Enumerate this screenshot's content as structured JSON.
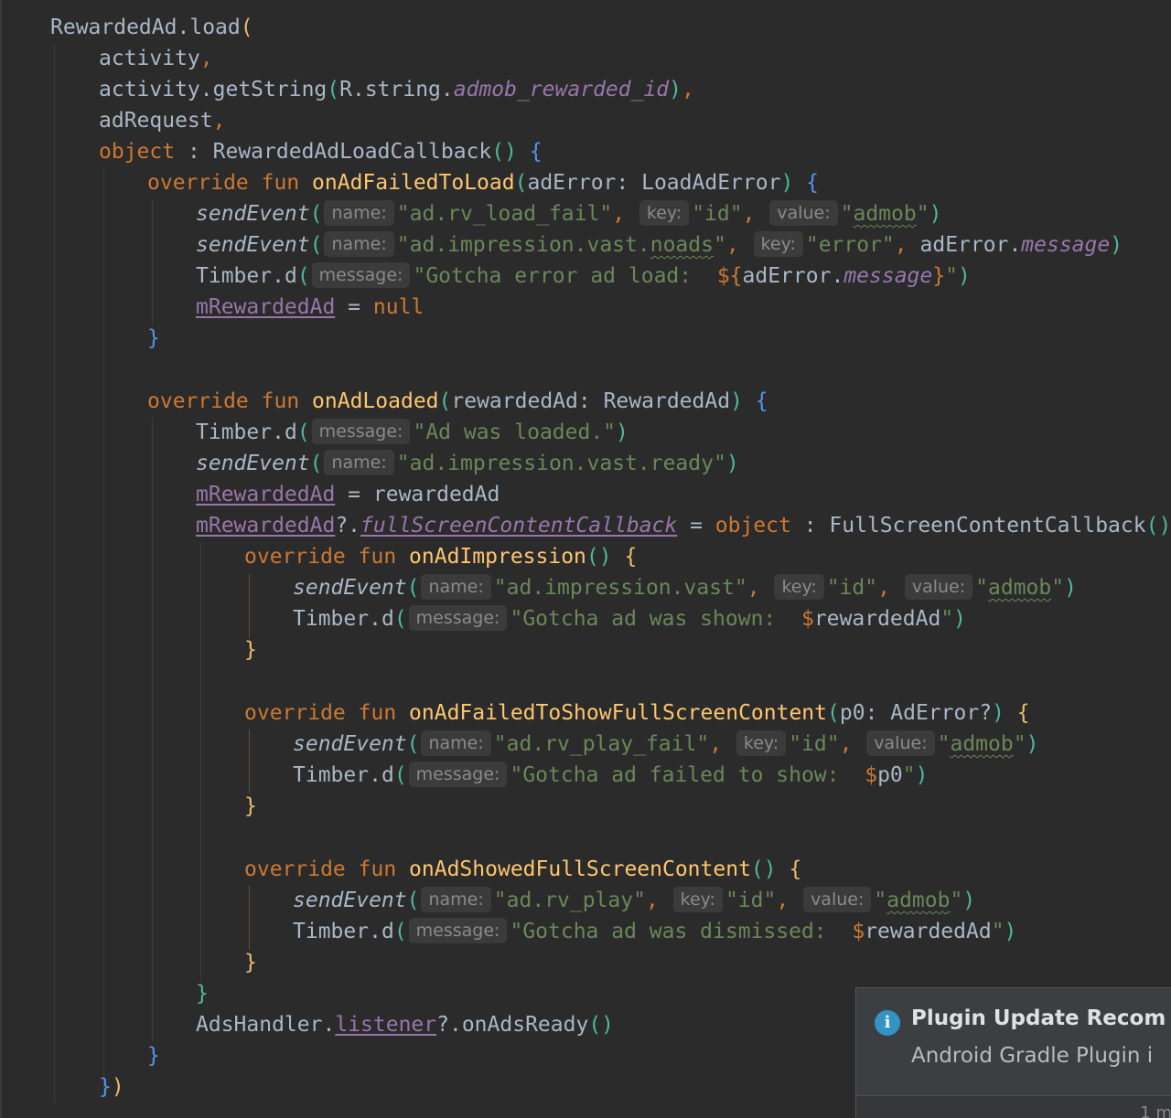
{
  "code": {
    "l1_obj": "RewardedAd",
    "l1_method": "load",
    "l2": "activity",
    "l3_obj": "activity",
    "l3_method": "getString",
    "l3_r": "R.string.",
    "l3_id": "admob_rewarded_id",
    "l4": "adRequest",
    "l5_kw": "object",
    "l5_type": "RewardedAdLoadCallback",
    "override": "override",
    "fun": "fun",
    "f1_name": "onAdFailedToLoad",
    "f1_param": "adError",
    "f1_type": "LoadAdError",
    "send_event": "sendEvent",
    "hint_name": "name:",
    "hint_key": "key:",
    "hint_value": "value:",
    "hint_message": "message:",
    "l7_name": "\"ad.rv_load_fail\"",
    "q_id": "\"id\"",
    "admob": "admob",
    "l8_name_a": "\"ad.impression.vast.",
    "l8_name_b": "noads",
    "l8_key": "\"error\"",
    "ad_error": "adError",
    "message_prop": "message",
    "timber": "Timber",
    "timber_d": "d",
    "l9_str": "\"Gotcha error ad load:  ",
    "m_rewarded_ad": "mRewardedAd",
    "null_kw": "null",
    "f2_name": "onAdLoaded",
    "f2_param": "rewardedAd",
    "f2_type": "RewardedAd",
    "l14_str": "\"Ad was loaded.\"",
    "l15_name": "\"ad.impression.vast.ready\"",
    "rewarded_ad_var": "rewardedAd",
    "fsc_callback": "fullScreenContentCallback",
    "fsc_type": "FullScreenContentCallback",
    "f3_name": "onAdImpression",
    "l19_name": "\"ad.impression.vast\"",
    "l20_str": "\"Gotcha ad was shown:  ",
    "f4_name": "onAdFailedToShowFullScreenContent",
    "f4_param": "p0",
    "f4_type": "AdError?",
    "l24_name": "\"ad.rv_play_fail\"",
    "l25_str": "\"Gotcha ad failed to show:  ",
    "p0_var": "p0",
    "f5_name": "onAdShowedFullScreenContent",
    "l29_name": "\"ad.rv_play\"",
    "l30_str": "\"Gotcha ad was dismissed:  ",
    "ads_handler": "AdsHandler",
    "listener": "listener",
    "on_ads_ready": "onAdsReady"
  },
  "notification": {
    "icon": "info-icon",
    "title": "Plugin Update Recom",
    "body": "Android Gradle Plugin i",
    "footer": "1 m"
  }
}
